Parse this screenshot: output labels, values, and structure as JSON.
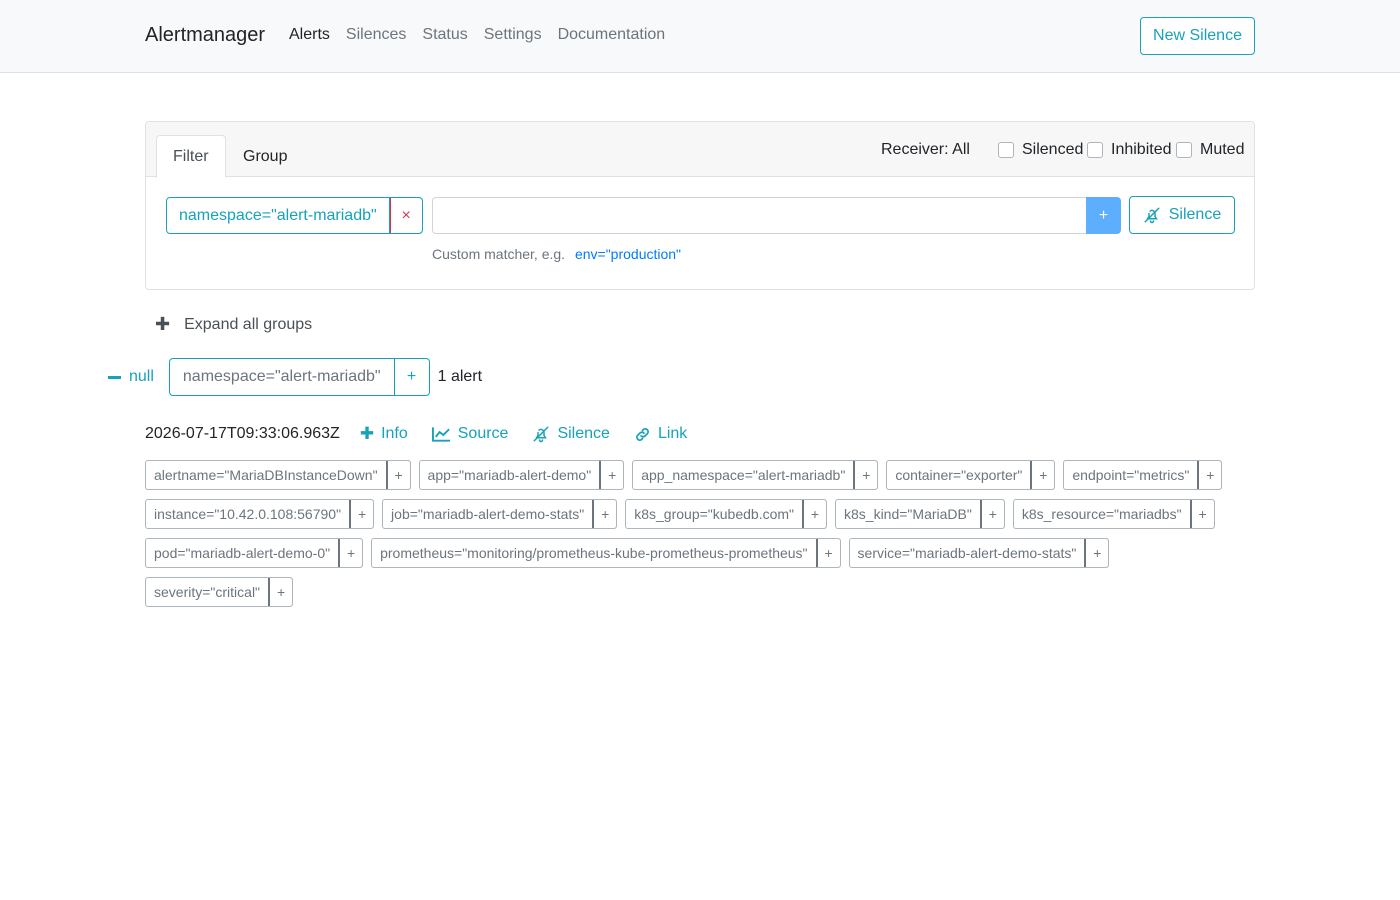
{
  "navbar": {
    "brand": "Alertmanager",
    "links": [
      "Alerts",
      "Silences",
      "Status",
      "Settings",
      "Documentation"
    ],
    "active_link": "Alerts",
    "new_silence_label": "New Silence"
  },
  "filter_card": {
    "tabs": [
      "Filter",
      "Group"
    ],
    "active_tab": "Filter",
    "receiver_label": "Receiver: All",
    "checkboxes": [
      {
        "label": "Silenced",
        "checked": false
      },
      {
        "label": "Inhibited",
        "checked": false
      },
      {
        "label": "Muted",
        "checked": false
      }
    ],
    "active_matcher": "namespace=\"alert-mariadb\"",
    "remove_label": "×",
    "custom_input_value": "",
    "add_label": "+",
    "silence_label": "Silence",
    "hint_text": "Custom matcher, e.g.",
    "hint_example": "env=\"production\""
  },
  "expand": {
    "icon": "plus",
    "label": "Expand all groups"
  },
  "group": {
    "collapse_label": "null",
    "matcher": "namespace=\"alert-mariadb\"",
    "add_label": "+",
    "count_label": "1 alert"
  },
  "alert": {
    "timestamp": "2026-07-17T09:33:06.963Z",
    "actions": [
      {
        "label": "Info",
        "icon": "plus-icon"
      },
      {
        "label": "Source",
        "icon": "chart-line-icon"
      },
      {
        "label": "Silence",
        "icon": "bell-slash-icon"
      },
      {
        "label": "Link",
        "icon": "link-icon"
      }
    ],
    "labels": [
      "alertname=\"MariaDBInstanceDown\"",
      "app=\"mariadb-alert-demo\"",
      "app_namespace=\"alert-mariadb\"",
      "container=\"exporter\"",
      "endpoint=\"metrics\"",
      "instance=\"10.42.0.108:56790\"",
      "job=\"mariadb-alert-demo-stats\"",
      "k8s_group=\"kubedb.com\"",
      "k8s_kind=\"MariaDB\"",
      "k8s_resource=\"mariadbs\"",
      "pod=\"mariadb-alert-demo-0\"",
      "prometheus=\"monitoring/prometheus-kube-prometheus-prometheus\"",
      "service=\"mariadb-alert-demo-stats\"",
      "severity=\"critical\""
    ],
    "label_add": "+"
  },
  "colors": {
    "accent": "#17a2b8",
    "danger": "#dc3545",
    "primary_btn": "#5daffd",
    "link": "#007bff"
  }
}
